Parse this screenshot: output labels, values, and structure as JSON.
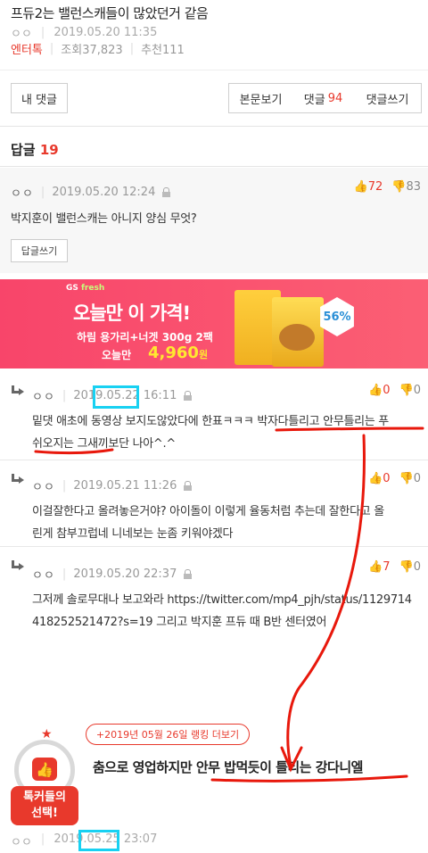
{
  "post": {
    "title": "프듀2는 밸런스캐들이 많았던거 같음",
    "author": "ㅇㅇ",
    "datetime": "2019.05.20 11:35",
    "category": "엔터톡",
    "views": "조회37,823",
    "recommends": "추천111"
  },
  "buttons": {
    "my_comments": "내 댓글",
    "view_body": "본문보기",
    "comments_label": "댓글",
    "comments_count": "94",
    "write_comment": "댓글쓰기"
  },
  "replies_header": {
    "label": "답글",
    "count": "19"
  },
  "main_comment": {
    "author": "ㅇㅇ",
    "datetime": "2019.05.20 12:24",
    "up": "72",
    "down": "83",
    "text": "박지훈이 밸런스캐는 아니지 양심 무엇?",
    "reply_button": "답글쓰기"
  },
  "ad": {
    "brand_prefix": "GS",
    "brand_suffix": "fresh",
    "headline": "오늘만 이 가격!",
    "description": "하림 용가리+너겟 300g 2팩",
    "price_label": "오늘만",
    "price": "4,960",
    "price_unit": "원",
    "discount": "56%"
  },
  "replies": [
    {
      "author": "ㅇㅇ",
      "datetime": "2019.05.22 16:11",
      "up": "0",
      "down": "0",
      "text_line1": "밑댓 애초에 동영상 보지도않았다에 한표ㅋㅋㅋ 박자다틀리고 안무틀리는 푸",
      "text_line2": "쉬오지는 그새끼보단 나아^.^"
    },
    {
      "author": "ㅇㅇ",
      "datetime": "2019.05.21 11:26",
      "up": "0",
      "down": "0",
      "text_line1": "이걸잘한다고 올려놓은거야? 아이돌이 이렇게 율동처럼 추는데 잘한다고 올",
      "text_line2": "린게 참부끄럽네 니네보는 눈좀 키워야겠다"
    },
    {
      "author": "ㅇㅇ",
      "datetime": "2019.05.20 22:37",
      "up": "7",
      "down": "0",
      "text_line1": "그저께 솔로무대나 보고와라 https://twitter.com/mp4_pjh/status/1129714",
      "text_line2": "418252521472?s=19 그리고 박지훈 프듀 때 B반 센터였어"
    }
  ],
  "ranking": {
    "link": "+2019년 05월 26일 랭킹 더보기",
    "title": "춤으로 영업하지만 안무 밥먹듯이 틀리는 강다니엘",
    "badge_line1": "톡커들의",
    "badge_line2": "선택!",
    "author": "ㅇㅇ",
    "datetime": "2019.05.25 23:07"
  },
  "colors": {
    "accent": "#e8392c",
    "ad_background": "#f8456a",
    "highlight_box": "#18d1f2",
    "annotation_stroke": "#e8180c"
  },
  "icons": {
    "lock": "lock-icon",
    "thumb_up": "thumb-up-icon",
    "thumb_down": "thumb-down-icon",
    "reply_arrow": "reply-arrow-icon",
    "medal": "thumbs-up-medal-icon"
  }
}
